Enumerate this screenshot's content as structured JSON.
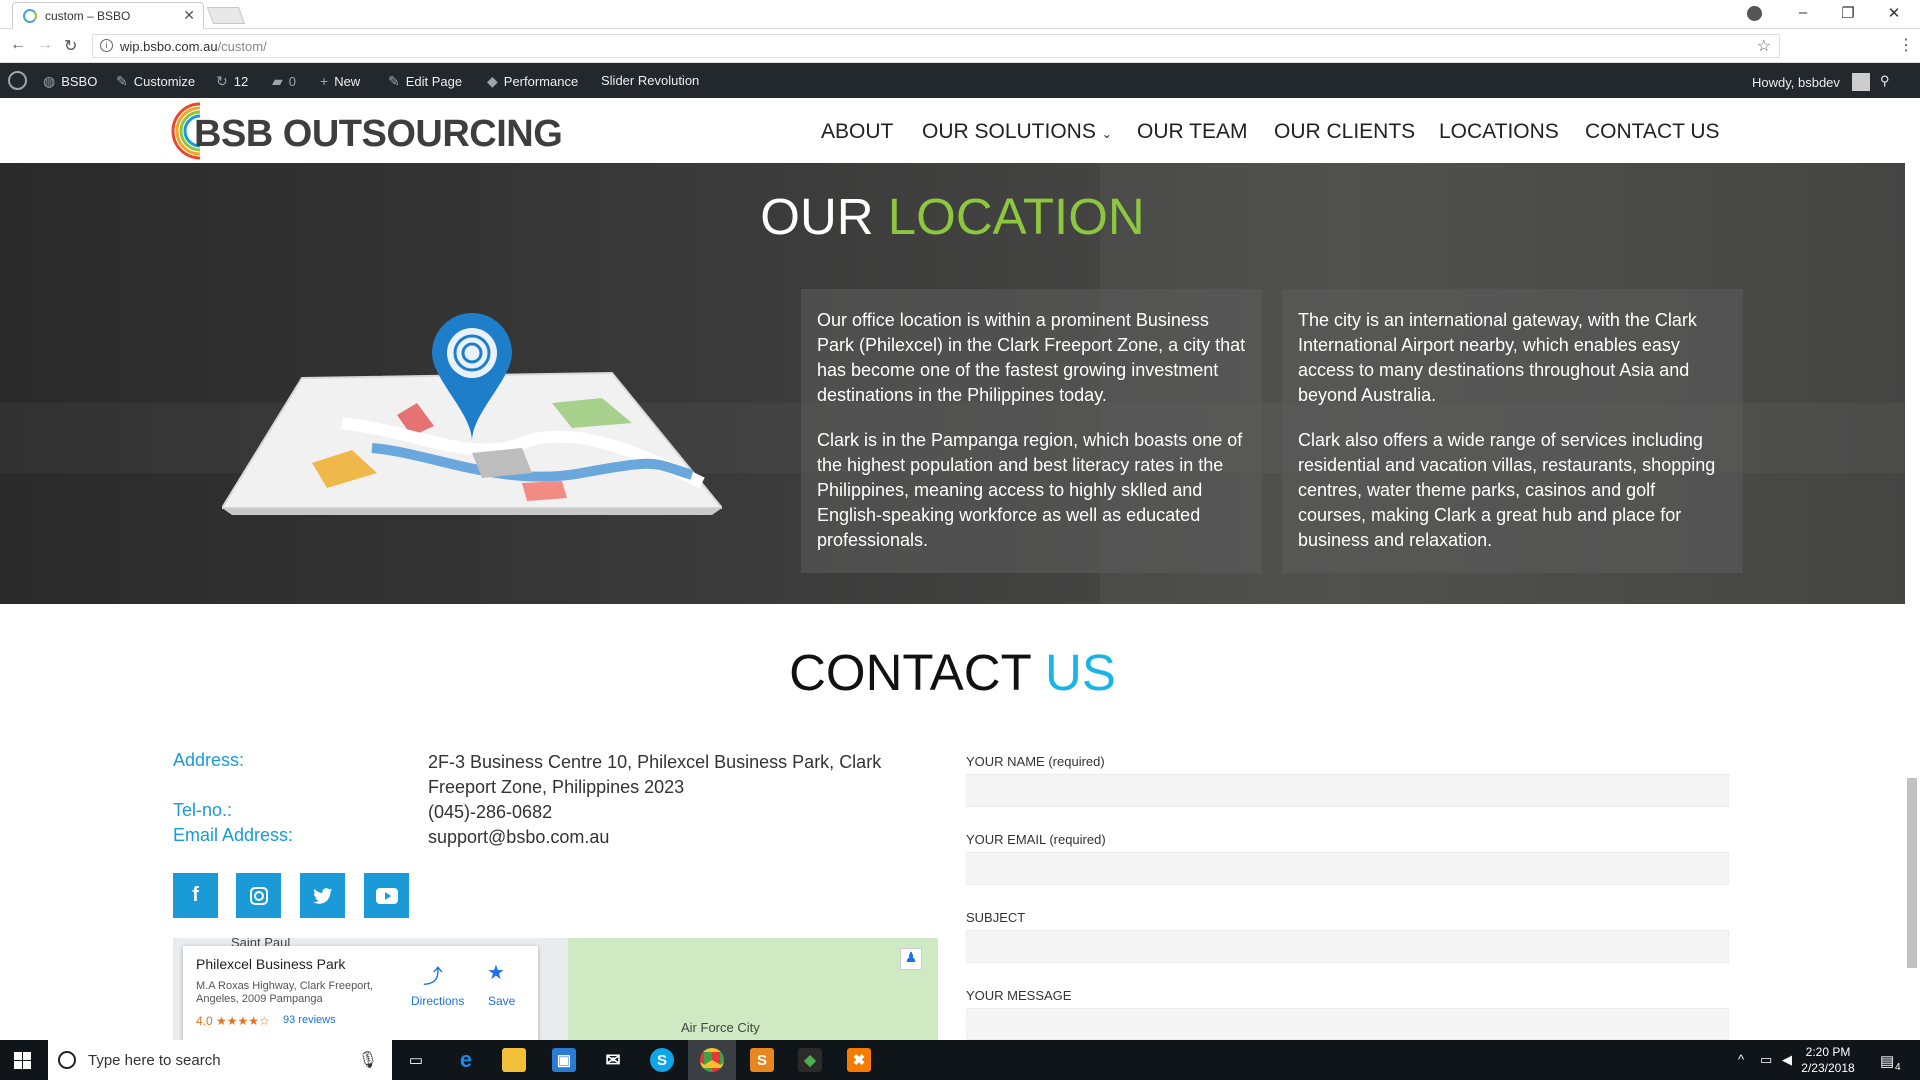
{
  "browser": {
    "tab_title": "custom – BSBO",
    "url_host": "wip.bsbo.com.au",
    "url_path": "/custom/"
  },
  "wp_admin_bar": {
    "site_name": "BSBO",
    "customize": "Customize",
    "updates_count": "12",
    "comments_count": "0",
    "new": "New",
    "edit_page": "Edit Page",
    "performance": "Performance",
    "slider_revolution": "Slider Revolution",
    "howdy": "Howdy, bsbdev"
  },
  "site": {
    "logo_text": "BSB OUTSOURCING",
    "nav": [
      "ABOUT",
      "OUR SOLUTIONS",
      "OUR TEAM",
      "OUR CLIENTS",
      "LOCATIONS",
      "CONTACT US"
    ]
  },
  "location": {
    "title_part1": "OUR",
    "title_part2": "LOCATION",
    "box1": {
      "p1": "Our office location is within a prominent Business Park (Philexcel) in the Clark Freeport Zone, a city that has become one of the fastest growing investment destinations in the Philippines today.",
      "p2": "Clark is in the Pampanga region, which boasts one of the highest population and best literacy rates in the Philippines, meaning access to highly sklled and English-speaking workforce as well as educated professionals."
    },
    "box2": {
      "p1": "The city is an international gateway, with the Clark International Airport nearby, which enables easy access to many destinations throughout Asia and beyond Australia.",
      "p2": "Clark also offers a wide range of services including residential and vacation villas, restaurants, shopping centres, water theme parks, casinos and golf courses, making Clark a great hub and place for business and relaxation."
    }
  },
  "contact": {
    "title_part1": "CONTACT",
    "title_part2": "US",
    "address_label": "Address:",
    "address_value": "2F-3 Business Centre 10, Philexcel Business Park, Clark Freeport Zone, Philippines 2023",
    "tel_label": "Tel-no.:",
    "tel_value": "(045)-286-0682",
    "email_label": "Email Address:",
    "email_value": "support@bsbo.com.au",
    "social": [
      "f",
      "instagram",
      "twitter",
      "youtube"
    ],
    "map": {
      "place_name": "Philexcel Business Park",
      "place_address": "M.A Roxas Highway, Clark Freeport, Angeles, 2009 Pampanga",
      "rating": "4.0 ★★★★☆",
      "reviews": "93 reviews",
      "directions": "Directions",
      "save": "Save",
      "label_saint_paul": "Saint Paul",
      "label_air_force_city": "Air Force City"
    },
    "form": {
      "name_label": "YOUR NAME (required)",
      "email_label": "YOUR EMAIL (required)",
      "subject_label": "SUBJECT",
      "message_label": "YOUR MESSAGE"
    }
  },
  "taskbar": {
    "search_placeholder": "Type here to search",
    "time": "2:20 PM",
    "date": "2/23/2018",
    "notifications": "4"
  },
  "colors": {
    "brand_blue": "#1a9ad6",
    "accent_green": "#8dc63f",
    "accent_cyan": "#1ab5e8",
    "wp_bar": "#23282d"
  }
}
